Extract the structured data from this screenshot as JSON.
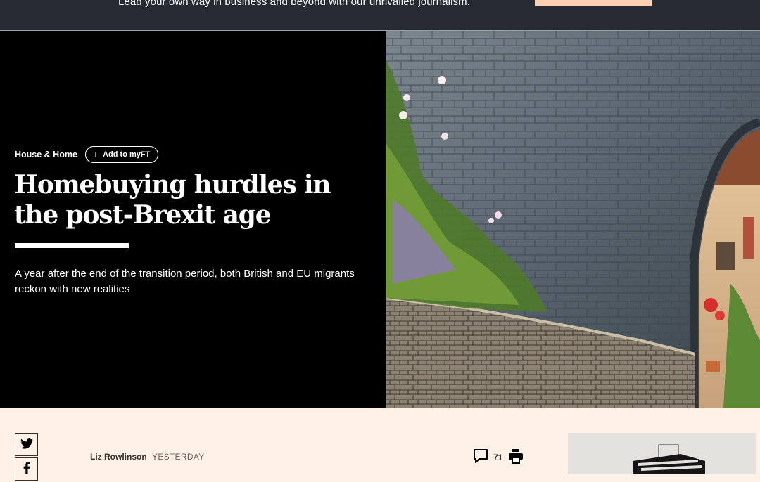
{
  "promo": {
    "text": "Lead your own way in business and beyond with our unrivalled journalism.",
    "cta_color": "#fcd0b1"
  },
  "article": {
    "topic": "House & Home",
    "myft_label": "Add to myFT",
    "headline": "Homebuying hurdles in the post-Brexit age",
    "standfirst": "A year after the end of the transition period, both British and EU migrants reckon with new realities",
    "hero_image": "stone-wall-archway-village-photo"
  },
  "byline": {
    "author": "Liz Rowlinson",
    "time": "YESTERDAY"
  },
  "share": {
    "icons": [
      "twitter-icon",
      "facebook-icon"
    ]
  },
  "tools": {
    "comment_count": "71",
    "icons": [
      "comment-icon",
      "print-icon"
    ]
  },
  "colors": {
    "page_bg": "#fff1e5",
    "banner_bg": "#262a33",
    "hero_bg": "#000000"
  }
}
